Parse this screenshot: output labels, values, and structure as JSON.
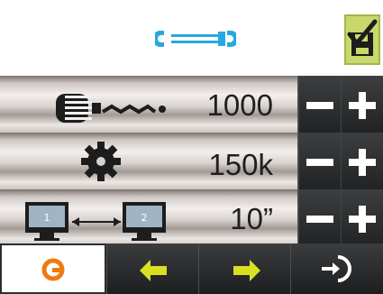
{
  "header": {
    "title_icon": "wrench-icon",
    "save_icon": "save-check-icon",
    "colors": {
      "accent": "#28a8e0",
      "save_bg": "#c9d86a"
    }
  },
  "rows": [
    {
      "icon": "cable-length-icon",
      "value": "1000"
    },
    {
      "icon": "gear-icon",
      "value": "150k"
    },
    {
      "icon": "monitor-switch-icon",
      "value": "10”",
      "monitor_a": "1",
      "monitor_b": "2"
    }
  ],
  "controls": {
    "minus_icon": "minus-icon",
    "plus_icon": "plus-icon"
  },
  "footer": {
    "home_icon": "home-circle-icon",
    "back_icon": "back-arrow-icon",
    "forward_icon": "forward-arrow-icon",
    "exit_icon": "exit-icon",
    "colors": {
      "home": "#f07a10",
      "arrows": "#d8e020",
      "exit": "#ffffff"
    }
  }
}
